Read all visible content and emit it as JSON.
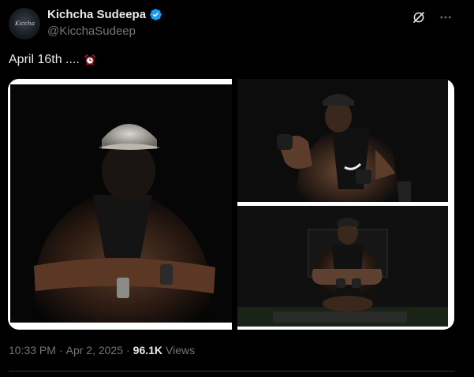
{
  "author": {
    "display_name": "Kichcha Sudeepa",
    "handle": "@KicchaSudeep",
    "avatar_text": "Kiccha",
    "verified": true
  },
  "actions": {
    "grok_icon": "grok-icon",
    "more_icon": "more-icon"
  },
  "tweet": {
    "text": "April 16th ....",
    "emoji": "alarm-clock-icon"
  },
  "media": {
    "count": 3
  },
  "meta": {
    "time": "10:33 PM",
    "separator1": "·",
    "date": "Apr 2, 2025",
    "separator2": "·",
    "views_count": "96.1K",
    "views_label": "Views"
  },
  "colors": {
    "background": "#000000",
    "verified_blue": "#1d9bf0",
    "muted_text": "#71767b",
    "primary_text": "#e7e9ea"
  }
}
